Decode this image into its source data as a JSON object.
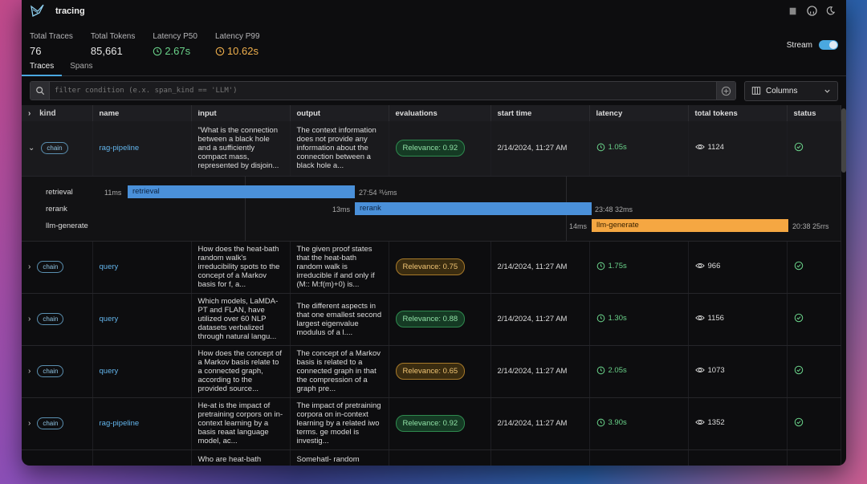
{
  "app": {
    "title": "tracing"
  },
  "stats": [
    {
      "label": "Total Traces",
      "value": "76"
    },
    {
      "label": "Total Tokens",
      "value": "85,661"
    },
    {
      "label": "Latency P50",
      "value": "2.67s"
    },
    {
      "label": "Latency P99",
      "value": "10.62s"
    }
  ],
  "stream": {
    "label": "Stream"
  },
  "tabs": [
    "Traces",
    "Spans"
  ],
  "filter": {
    "placeholder": "filter condition (e.x. span_kind == 'LLM')"
  },
  "columns_button": "Columns",
  "headers": [
    "kind",
    "name",
    "input",
    "output",
    "evaluations",
    "start time",
    "latency",
    "total tokens",
    "status"
  ],
  "rows": [
    {
      "kind": "chain",
      "name": "rag-pipeline",
      "input": "\"What is the connection between a black hole and a sufficiently compact mass, represented by disjoin...",
      "output": "The context information does not provide any information about the connection between a black hole a...",
      "evaluation": "Relevance: 0.92",
      "start": "2/14/2024, 11:27 AM",
      "latency": "1.05s",
      "tokens": "1124"
    },
    {
      "kind": "chain",
      "name": "query",
      "input": "How does the heat-bath random walk's irreducibility spots to the concept of a Markov basis for f, a...",
      "output": "The given proof states that the heat-bath random walk is irreducible if and only if (M:: M:f(m)+0) is...",
      "evaluation": "Relevance: 0.75",
      "start": "2/14/2024, 11:27 AM",
      "latency": "1.75s",
      "tokens": "966"
    },
    {
      "kind": "chain",
      "name": "query",
      "input": "Which models, LaMDA-PT and FLAN, have utilized over 60 NLP datasets verbalized through natural langu...",
      "output": "The different aspects in that one emallest second largest eigenvalue modulus of a l....",
      "evaluation": "Relevance: 0.88",
      "start": "2/14/2024, 11:27 AM",
      "latency": "1.30s",
      "tokens": "1156"
    },
    {
      "kind": "chain",
      "name": "query",
      "input": "How does the concept of a Markov basis relate to a connected graph, according to the provided source...",
      "output": "The concept of a Markov basis is related to a connected graph in that the compression of a graph pre...",
      "evaluation": "Relevance: 0.65",
      "start": "2/14/2024, 11:27 AM",
      "latency": "2.05s",
      "tokens": "1073"
    },
    {
      "kind": "chain",
      "name": "rag-pipeline",
      "input": "He-at is the impact of pretraining corpors on in-context learning by a basis reaat language model, ac...",
      "output": "The impact of pretraining corpora on in-context learning by a related iwo terms. ge model is investig...",
      "evaluation": "Relevance: 0.92",
      "start": "2/14/2024, 11:27 AM",
      "latency": "3.90s",
      "tokens": "1352"
    },
    {
      "kind": "",
      "name": "",
      "input": "Who are heat-bath",
      "output": "Somehatl- random",
      "evaluation": "",
      "start": "",
      "latency": "",
      "tokens": ""
    }
  ],
  "waterfall": [
    {
      "label": "retrieval",
      "start_text": "11ms",
      "bar": "retrieval",
      "end_text": "27:54 ³½ms",
      "color": "#4a90d9"
    },
    {
      "label": "rerank",
      "start_text": "13ms",
      "bar": "rerank",
      "end_text": "23:48 32ms",
      "color": "#4a90d9"
    },
    {
      "label": "llm-generate",
      "start_text": "14ms",
      "bar": "llm-generate",
      "end_text": "20:38 25rrs",
      "color": "#f5a742"
    }
  ]
}
